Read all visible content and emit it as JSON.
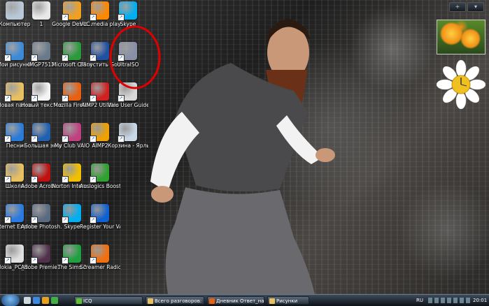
{
  "desktop": {
    "icons": [
      {
        "label": "Компьютер",
        "icon": "computer-icon",
        "color": "#b8c8d8"
      },
      {
        "label": "1",
        "icon": "green-emblem-icon",
        "color": "#e8e8e8"
      },
      {
        "label": "Google Deskt...",
        "icon": "google-desktop-icon",
        "color": "#f0a020"
      },
      {
        "label": "VLC media player",
        "icon": "vlc-cone-icon",
        "color": "#ff8800"
      },
      {
        "label": "Skype",
        "icon": "skype-icon",
        "color": "#00aff0"
      },
      {
        "label": "Мои рисунки",
        "icon": "pictures-folder-icon",
        "color": "#3a8ad8"
      },
      {
        "label": "IMGP7512",
        "icon": "photo-thumbnail-icon",
        "color": "#6a7a8a"
      },
      {
        "label": "Microsoft Office - 60...",
        "icon": "office-icon",
        "color": "#2a9a3a"
      },
      {
        "label": "Запустить Google...",
        "icon": "google-earth-icon",
        "color": "#2050a0"
      },
      {
        "label": "UltraISO",
        "icon": "ultraiso-disc-icon",
        "color": "#8890a8"
      },
      {
        "label": "Новая папка",
        "icon": "folder-icon",
        "color": "#e8c060"
      },
      {
        "label": "Новый текстов...",
        "icon": "text-document-icon",
        "color": "#f4f4f4"
      },
      {
        "label": "Mozilla Firefox",
        "icon": "firefox-icon",
        "color": "#e86010"
      },
      {
        "label": "AIMP2 Utilities",
        "icon": "aimp-utilities-icon",
        "color": "#d02020"
      },
      {
        "label": "Vaio User Guide",
        "icon": "vaio-guide-icon",
        "color": "#d8d8d8"
      },
      {
        "label": "Песни",
        "icon": "music-globe-icon",
        "color": "#2a7ad8"
      },
      {
        "label": "«Большая энциклоп...",
        "icon": "encyclopedia-icon",
        "color": "#2060b0"
      },
      {
        "label": "My Club VAIO",
        "icon": "club-vaio-icon",
        "color": "#c04080"
      },
      {
        "label": "AIMP2",
        "icon": "aimp-icon",
        "color": "#f0a000"
      },
      {
        "label": "Корзина - Ярлык",
        "icon": "recycle-bin-icon",
        "color": "#c8d8e8"
      },
      {
        "label": "Школа",
        "icon": "folder-icon",
        "color": "#e8c060"
      },
      {
        "label": "Adobe Acroba...",
        "icon": "acrobat-icon",
        "color": "#c01010"
      },
      {
        "label": "Norton Intern...",
        "icon": "norton-icon",
        "color": "#f0c000"
      },
      {
        "label": "Auslogics BoostSpeed",
        "icon": "boostspeed-icon",
        "color": "#30a030"
      },
      {
        "label": "Internet Explorer",
        "icon": "internet-explorer-icon",
        "color": "#2a7ae0"
      },
      {
        "label": "Adobe Photosh...",
        "icon": "photoshop-icon",
        "color": "#5a6a80"
      },
      {
        "label": "Skype",
        "icon": "skype-icon",
        "color": "#00aff0"
      },
      {
        "label": "Register Your VAIO",
        "icon": "register-vaio-icon",
        "color": "#1060d0"
      },
      {
        "label": "Nokia_PC_S...",
        "icon": "nokia-icon",
        "color": "#e0e0e0"
      },
      {
        "label": "Adobe Premie...",
        "icon": "premiere-icon",
        "color": "#50304a"
      },
      {
        "label": "The Sims 2",
        "icon": "sims-icon",
        "color": "#20a040"
      },
      {
        "label": "Screamer Radio",
        "icon": "screamer-radio-icon",
        "color": "#f07010"
      }
    ]
  },
  "gadgets": {
    "add_label": "+",
    "photo_colors": [
      "#f09018",
      "#ffd040",
      "#5a8a2a"
    ],
    "clock_time_hint": "analog"
  },
  "taskbar": {
    "quick_launch_colors": [
      "#d0d8e0",
      "#3a8ae0",
      "#e8a020",
      "#40b040"
    ],
    "buttons": [
      {
        "label": "ICQ",
        "icon": "icq-flower-icon",
        "color": "#60c030"
      },
      {
        "label": "Всего разговоров: ...",
        "icon": "chat-window-icon",
        "color": "#e8c060"
      },
      {
        "label": "Дневник Ответ_на_...",
        "icon": "firefox-icon",
        "color": "#e86010"
      },
      {
        "label": "Рисунки",
        "icon": "folder-icon",
        "color": "#e8c060"
      }
    ],
    "language": "RU",
    "time": "20:01"
  }
}
